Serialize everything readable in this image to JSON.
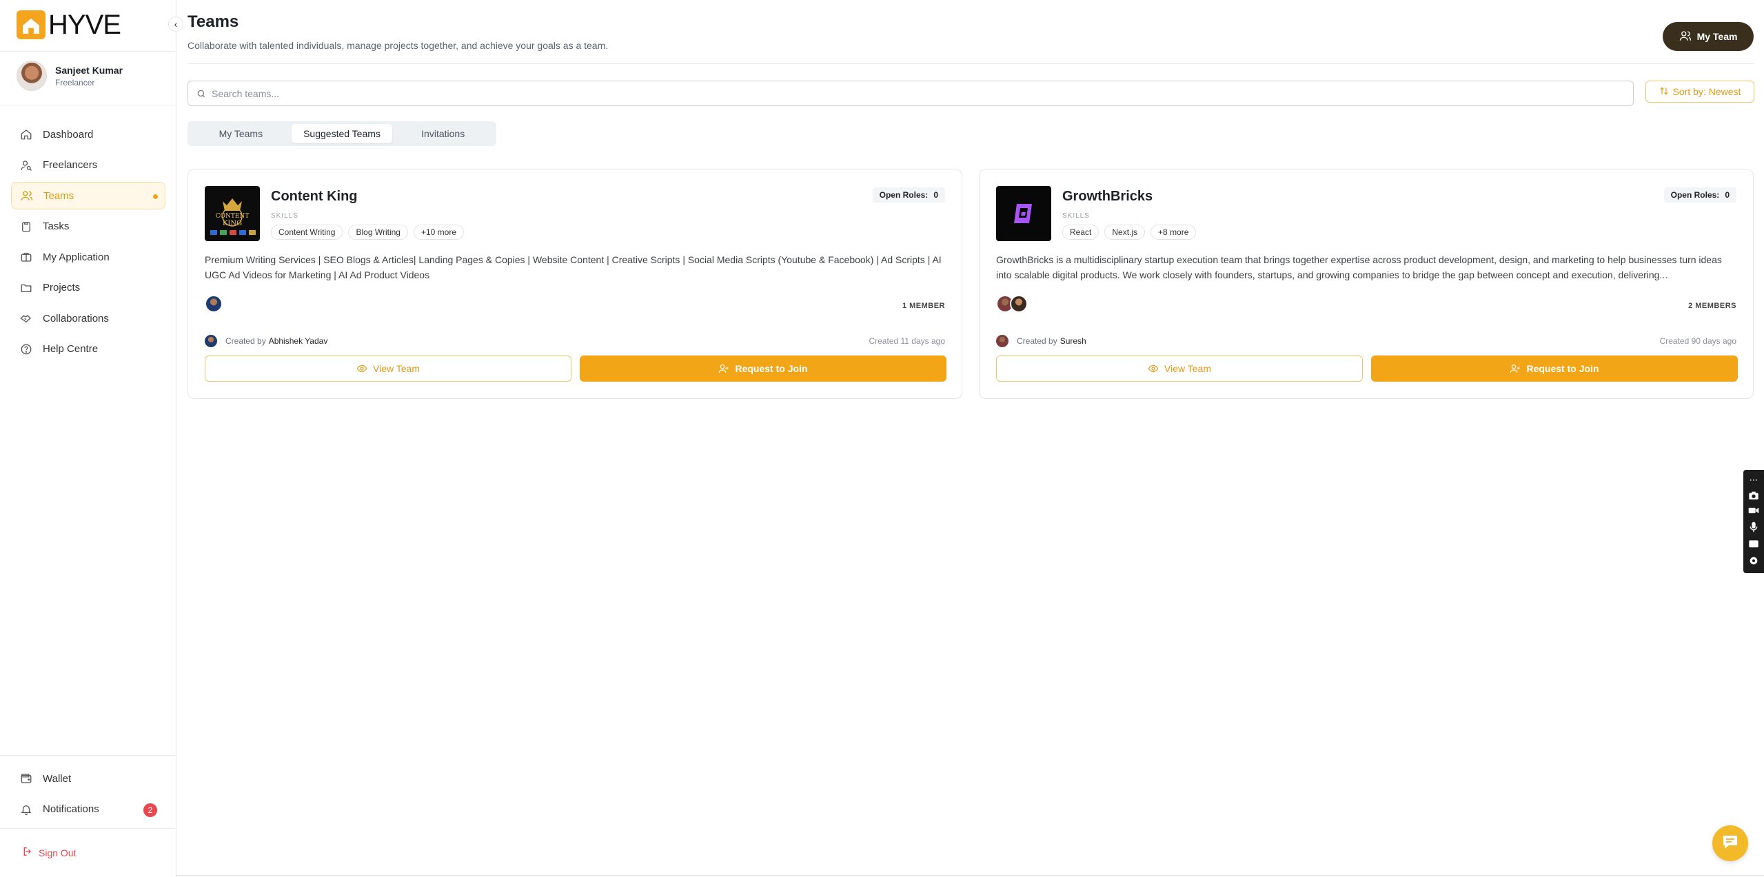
{
  "app": {
    "logo_text": "HYVE"
  },
  "user": {
    "name": "Sanjeet Kumar",
    "role": "Freelancer"
  },
  "nav": {
    "items": [
      {
        "label": "Dashboard",
        "icon": "home-icon"
      },
      {
        "label": "Freelancers",
        "icon": "user-search-icon"
      },
      {
        "label": "Teams",
        "icon": "users-icon"
      },
      {
        "label": "Tasks",
        "icon": "clipboard-icon"
      },
      {
        "label": "My Application",
        "icon": "briefcase-icon"
      },
      {
        "label": "Projects",
        "icon": "folder-icon"
      },
      {
        "label": "Collaborations",
        "icon": "handshake-icon"
      },
      {
        "label": "Help Centre",
        "icon": "help-circle-icon"
      }
    ],
    "active": "Teams",
    "bottom": [
      {
        "label": "Wallet",
        "icon": "wallet-icon"
      },
      {
        "label": "Notifications",
        "icon": "bell-icon",
        "badge": "2"
      }
    ],
    "signout": "Sign Out"
  },
  "header": {
    "title": "Teams",
    "subtitle": "Collaborate with talented individuals, manage projects together, and achieve your goals as a team.",
    "my_team_button": "My Team"
  },
  "search": {
    "placeholder": "Search teams..."
  },
  "sort": {
    "label": "Sort by: Newest"
  },
  "tabs": [
    {
      "label": "My Teams"
    },
    {
      "label": "Suggested Teams"
    },
    {
      "label": "Invitations"
    }
  ],
  "active_tab": "Suggested Teams",
  "teams": [
    {
      "name": "Content King",
      "skills_label": "SKILLS",
      "skills": [
        "Content Writing",
        "Blog Writing",
        "+10 more"
      ],
      "open_roles_label": "Open Roles:",
      "open_roles": "0",
      "description": "Premium Writing Services | SEO Blogs & Articles| Landing Pages & Copies | Website Content | Creative Scripts | Social Media Scripts (Youtube & Facebook) | Ad Scripts | AI UGC Ad Videos for Marketing | AI Ad Product Videos",
      "member_count": "1 MEMBER",
      "created_by_label": "Created by",
      "created_by": "Abhishek Yadav",
      "created_ago": "Created 11 days ago",
      "view_label": "View Team",
      "join_label": "Request to Join",
      "logo_text": "CONTENT KING"
    },
    {
      "name": "GrowthBricks",
      "skills_label": "SKILLS",
      "skills": [
        "React",
        "Next.js",
        "+8 more"
      ],
      "open_roles_label": "Open Roles:",
      "open_roles": "0",
      "description": "GrowthBricks is a multidisciplinary startup execution team that brings together expertise across product development, design, and marketing to help businesses turn ideas into scalable digital products. We work closely with founders, startups, and growing companies to bridge the gap between concept and execution, delivering...",
      "member_count": "2 MEMBERS",
      "created_by_label": "Created by",
      "created_by": "Suresh",
      "created_ago": "Created 90 days ago",
      "view_label": "View Team",
      "join_label": "Request to Join"
    }
  ],
  "colors": {
    "accent": "#f2a516",
    "dark_button": "#3a2f1c",
    "badge": "#e5484d"
  }
}
